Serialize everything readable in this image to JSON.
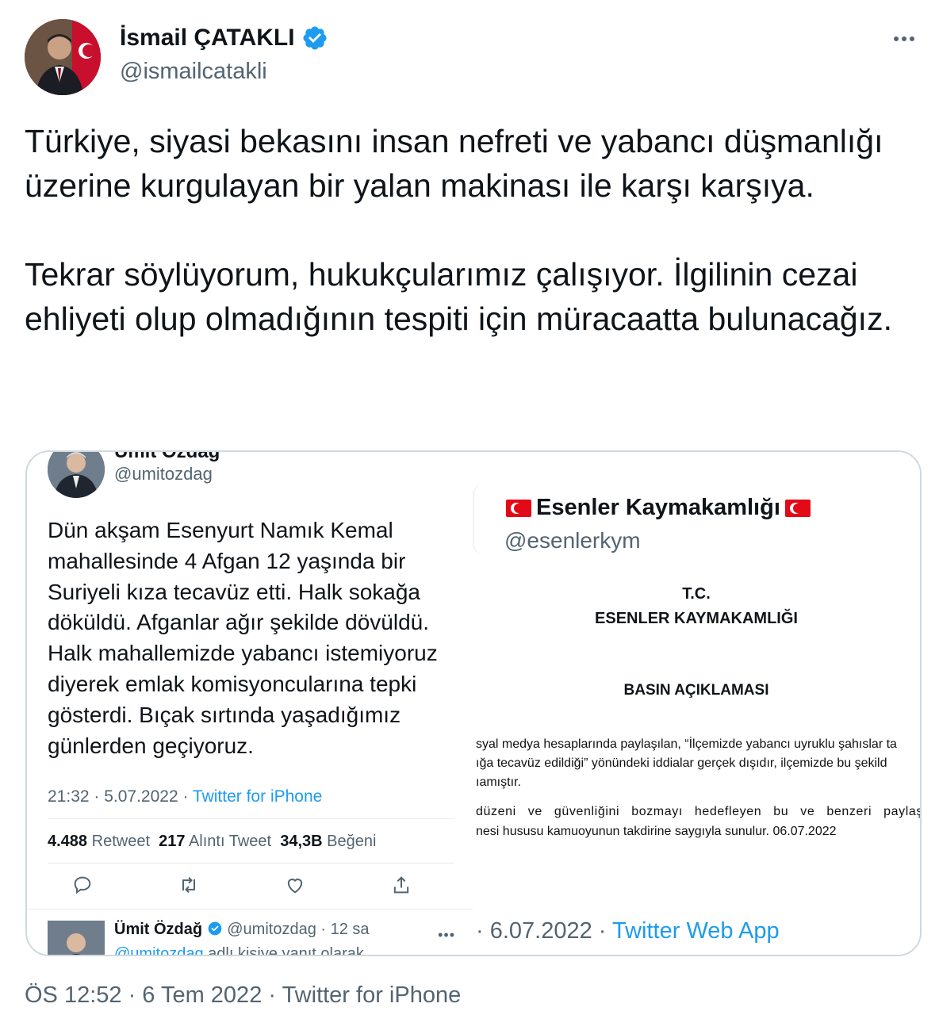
{
  "author": {
    "name": "İsmail ÇATAKLI",
    "handle": "@ismailcatakli",
    "verified_color": "#1d9bf0"
  },
  "tweet": {
    "paragraph1": "Türkiye, siyasi bekasını insan nefreti ve yabancı düşmanlığı üzerine kurgulayan bir yalan makinası ile karşı karşıya.",
    "paragraph2": "Tekrar söylüyorum, hukukçularımız çalışıyor. İlgilinin cezai ehliyeti olup olmadığının tespiti için müracaatta bulunacağız."
  },
  "left_screenshot": {
    "name": "Ümit Özdağ",
    "handle": "@umitozdag",
    "text": "Dün akşam Esenyurt Namık Kemal mahallesinde 4 Afgan 12 yaşında bir Suriyeli kıza tecavüz etti. Halk sokağa döküldü. Afganlar ağır şekilde dövüldü. Halk mahallemizde yabancı istemiyoruz diyerek emlak komisyoncularına tepki gösterdi. Bıçak sırtında yaşadığımız günlerden geçiyoruz.",
    "time": "21:32 · 5.07.2022 · ",
    "source": "Twitter for iPhone",
    "retweets": "4.488",
    "retweets_label": "Retweet",
    "quotes": "217",
    "quotes_label": "Alıntı Tweet",
    "likes": "34,3B",
    "likes_label": "Beğeni",
    "reply": {
      "name": "Ümit Özdağ",
      "meta": "@umitozdag · 12 sa",
      "sub_handle": "@umitozdag",
      "sub_text": " adlı kişiye yanıt olarak"
    }
  },
  "right_screenshot": {
    "name": "Esenler Kaymakamlığı",
    "handle": "@esenlerkym",
    "doc_tc": "T.C.",
    "doc_org": "ESENLER KAYMAKAMLIĞI",
    "doc_title": "BASIN AÇIKLAMASI",
    "doc_lines": [
      "syal medya hesaplarında paylaşılan, “İlçemizde yabancı uyruklu şahıslar ta",
      "ığa tecavüz edildiği” yönündeki iddialar gerçek dışıdır, ilçemizde bu şekild",
      "ıamıştır.",
      "düzeni ve güvenliğini bozmayı hedefleyen bu ve benzeri paylaşımla",
      "nesi hususu kamuoyunun takdirine saygıyla sunulur. 06.07.2022"
    ],
    "date": "· 6.07.2022 · ",
    "source": "Twitter Web App"
  },
  "footer": {
    "meta": "ÖS 12:52 · 6 Tem 2022 · Twitter for iPhone"
  }
}
